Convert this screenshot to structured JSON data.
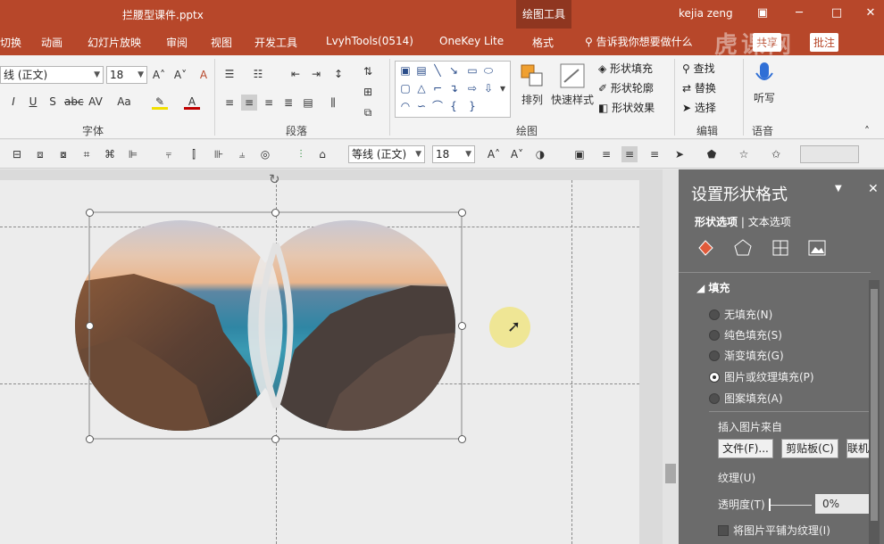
{
  "window": {
    "title": "拦腰型课件.pptx",
    "tool_tab": "绘图工具",
    "user": "kejia zeng",
    "accent": "#b7472a"
  },
  "menu": {
    "tabs": [
      "切换",
      "动画",
      "幻灯片放映",
      "审阅",
      "视图",
      "开发工具",
      "LvyhTools(0514)",
      "OneKey Lite",
      "格式"
    ],
    "search_placeholder": "告诉我你想要做什么",
    "share": "共享",
    "comment": "批注"
  },
  "ribbon": {
    "font_name": "线 (正文)",
    "font_size": "18",
    "group_font": "字体",
    "group_paragraph": "段落",
    "group_drawing": "绘图",
    "group_edit": "编辑",
    "group_voice": "语音",
    "arrange": "排列",
    "quick_styles": "快速样式",
    "shape_fill": "形状填充",
    "shape_outline": "形状轮廓",
    "shape_effects": "形状效果",
    "find": "查找",
    "replace": "替换",
    "select": "选择",
    "dictate": "听写"
  },
  "quickbar": {
    "font_name": "等线 (正文)",
    "font_size": "18"
  },
  "panel": {
    "title": "设置形状格式",
    "tab_shape": "形状选项",
    "tab_text": "文本选项",
    "section_fill": "填充",
    "options": [
      "无填充(N)",
      "纯色填充(S)",
      "渐变填充(G)",
      "图片或纹理填充(P)",
      "图案填充(A)"
    ],
    "selected_option": "图片或纹理填充(P)",
    "insert_from": "插入图片来自",
    "btn_file": "文件(F)...",
    "btn_clipboard": "剪贴板(C)",
    "btn_online": "联机",
    "texture": "纹理(U)",
    "transparency_label": "透明度(T)",
    "transparency_value": "0%",
    "tile_label": "将图片平铺为纹理(I)"
  },
  "watermark": "虎课网"
}
